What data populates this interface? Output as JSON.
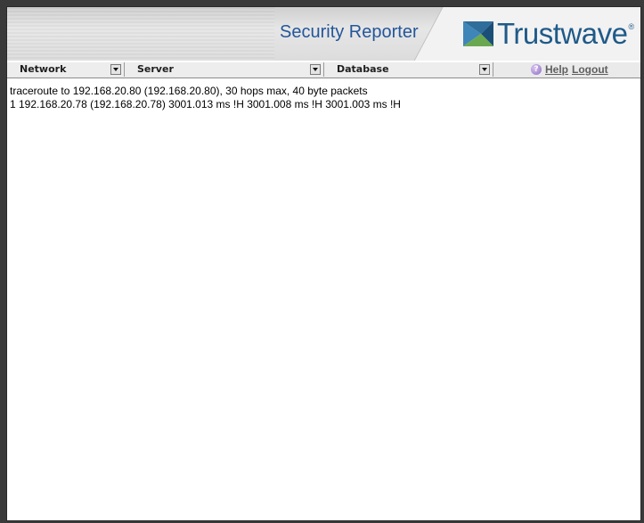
{
  "header": {
    "app_title": "Security Reporter",
    "brand_name": "Trustwave",
    "brand_mark": "®",
    "brand_color": "#1f5a89",
    "title_color": "#23569a"
  },
  "menubar": {
    "dropdowns": [
      {
        "label": "Network"
      },
      {
        "label": "Server"
      },
      {
        "label": "Database"
      }
    ],
    "help_icon": "help-icon",
    "help_label": "Help",
    "logout_label": "Logout"
  },
  "output": {
    "lines": [
      "traceroute to 192.168.20.80 (192.168.20.80), 30 hops max, 40 byte packets",
      "1 192.168.20.78 (192.168.20.78) 3001.013 ms !H 3001.008 ms !H 3001.003 ms !H"
    ]
  }
}
